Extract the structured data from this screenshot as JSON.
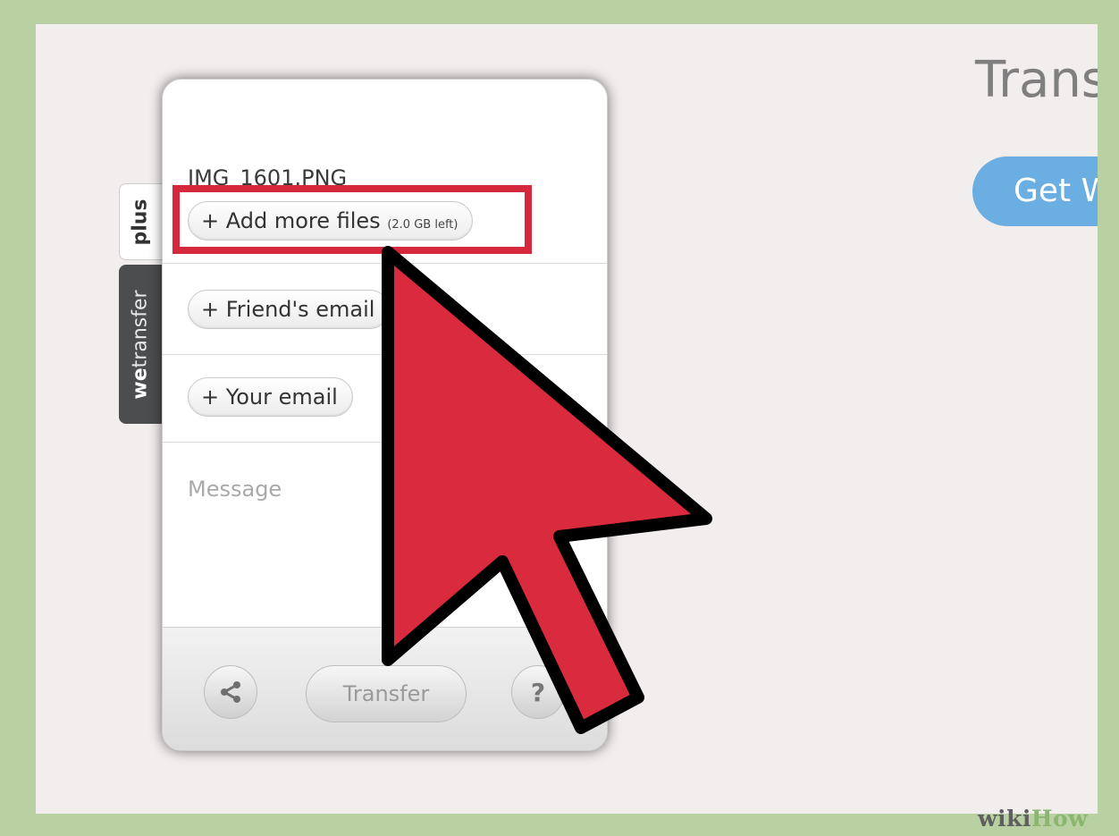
{
  "page": {
    "heading": "Trans",
    "cta_label": "Get W"
  },
  "side_tabs": {
    "plus_label": "plus",
    "brand_prefix": "we",
    "brand_suffix": "transfer"
  },
  "widget": {
    "file_name": "IMG_1601.PNG",
    "add_files_label": "+ Add more files",
    "add_files_remaining": "(2.0 GB left)",
    "friend_email_label": "+ Friend's email",
    "your_email_label": "+ Your email",
    "message_placeholder": "Message",
    "share_icon": "share-icon",
    "transfer_label": "Transfer",
    "help_label": "?"
  },
  "annotation": {
    "highlight_color": "#d5283c",
    "cursor_color": "#d92b3d",
    "cursor_icon": "arrow-cursor-icon"
  },
  "watermark": {
    "wiki": "wiki",
    "how": "How"
  },
  "colors": {
    "border": "#b9d1a2",
    "screen_bg": "#f3eeee",
    "cta": "#6aaee2"
  }
}
